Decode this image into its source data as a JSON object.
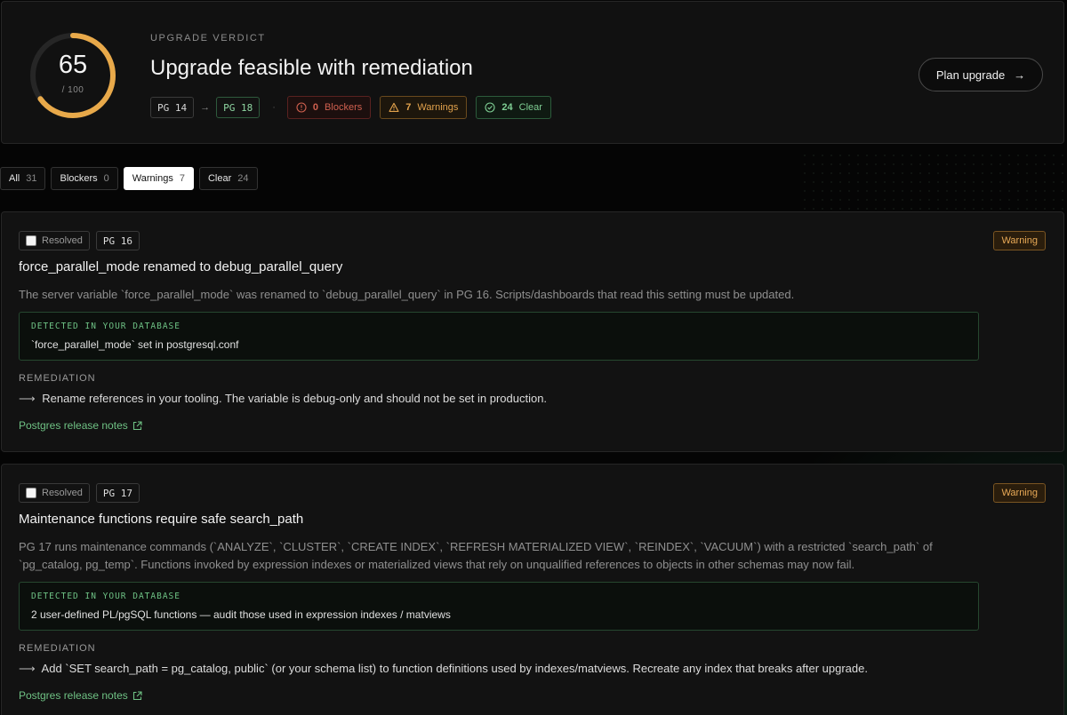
{
  "verdict": {
    "score": "65",
    "score_max": "/ 100",
    "score_fraction": 0.65,
    "eyebrow": "UPGRADE VERDICT",
    "title": "Upgrade feasible with remediation",
    "from_version": "PG 14",
    "to_version": "PG 18",
    "arrow": "→",
    "separator": "·",
    "blockers_count": "0",
    "blockers_label": "Blockers",
    "warnings_count": "7",
    "warnings_label": "Warnings",
    "clear_count": "24",
    "clear_label": "Clear",
    "plan_button": "Plan upgrade",
    "plan_arrow": "→",
    "colors": {
      "gauge": "#e8a94a",
      "blocker": "#d0604f",
      "warning": "#e2a24c",
      "clear": "#7fcf94"
    }
  },
  "filters": [
    {
      "label": "All",
      "count": "31"
    },
    {
      "label": "Blockers",
      "count": "0"
    },
    {
      "label": "Warnings",
      "count": "7",
      "active": true
    },
    {
      "label": "Clear",
      "count": "24"
    }
  ],
  "issues": [
    {
      "resolved_label": "Resolved",
      "version": "PG 16",
      "severity": "Warning",
      "title": "force_parallel_mode renamed to debug_parallel_query",
      "description": "The server variable `force_parallel_mode` was renamed to `debug_parallel_query` in PG 16. Scripts/dashboards that read this setting must be updated.",
      "detected_label": "DETECTED IN YOUR DATABASE",
      "detected_text": "`force_parallel_mode` set in postgresql.conf",
      "remediation_label": "REMEDIATION",
      "remediation_text": "Rename references in your tooling. The variable is debug-only and should not be set in production.",
      "link_label": "Postgres release notes"
    },
    {
      "resolved_label": "Resolved",
      "version": "PG 17",
      "severity": "Warning",
      "title": "Maintenance functions require safe search_path",
      "description": "PG 17 runs maintenance commands (`ANALYZE`, `CLUSTER`, `CREATE INDEX`, `REFRESH MATERIALIZED VIEW`, `REINDEX`, `VACUUM`) with a restricted `search_path` of `pg_catalog, pg_temp`. Functions invoked by expression indexes or materialized views that rely on unqualified references to objects in other schemas may now fail.",
      "detected_label": "DETECTED IN YOUR DATABASE",
      "detected_text": "2 user-defined PL/pgSQL functions — audit those used in expression indexes / matviews",
      "remediation_label": "REMEDIATION",
      "remediation_text": "Add `SET search_path = pg_catalog, public` (or your schema list) to function definitions used by indexes/matviews. Recreate any index that breaks after upgrade.",
      "link_label": "Postgres release notes"
    }
  ],
  "remediation_arrow": "⟶"
}
